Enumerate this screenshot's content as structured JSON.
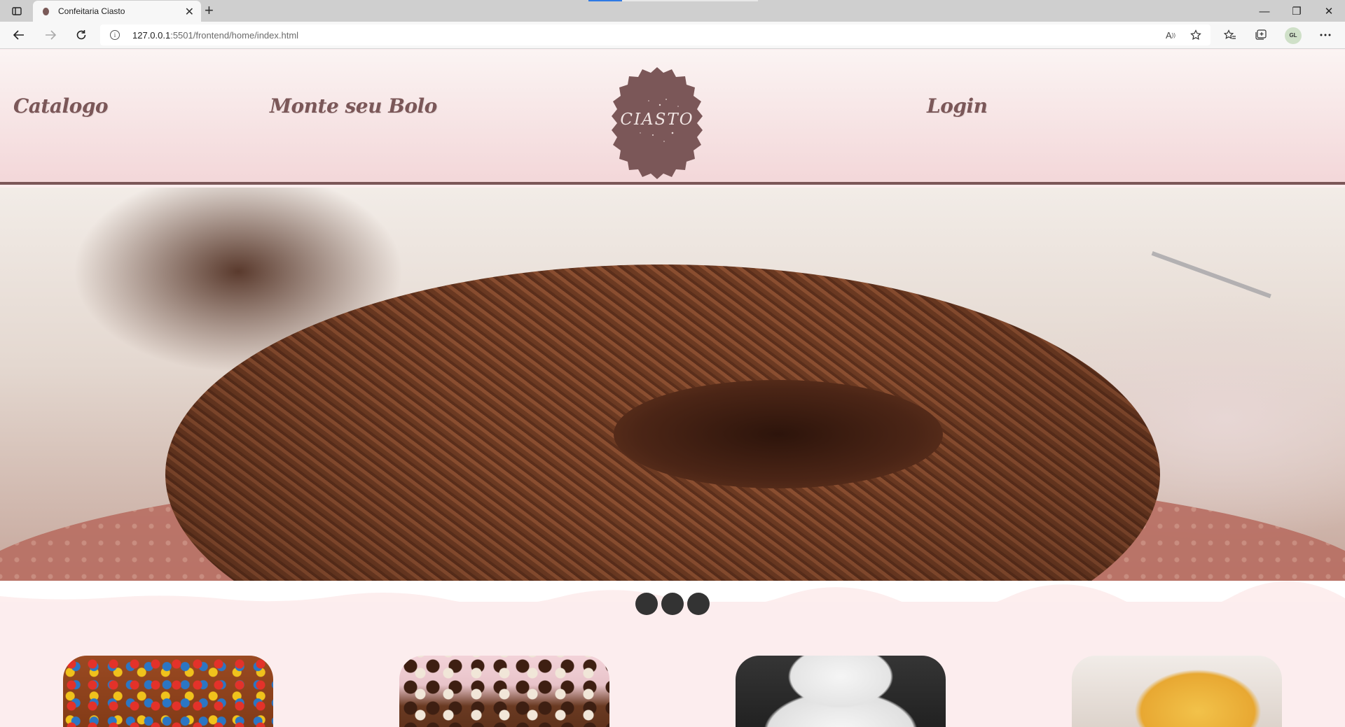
{
  "browser": {
    "tab_title": "Confeitaria Ciasto",
    "tab_close": "✕",
    "new_tab": "+",
    "url_host": "127.0.0.1",
    "url_rest": ":5501/frontend/home/index.html",
    "profile_initials": "GL",
    "window_controls": {
      "minimize": "—",
      "restore": "❐",
      "close": "✕"
    }
  },
  "site": {
    "nav": {
      "catalog": "Catalogo",
      "build_cake": "Monte seu Bolo",
      "login": "Login"
    },
    "logo_text": "CIASTO",
    "brand_color": "#7b5758",
    "header_gradient": [
      "#fbf4f3",
      "#f3d7d9"
    ],
    "slider": {
      "dots": [
        {
          "label": "slide-1"
        },
        {
          "label": "slide-2"
        },
        {
          "label": "slide-3"
        }
      ],
      "dot_color": "#333333"
    },
    "products": [
      {
        "image": "kitkat-mms-cake"
      },
      {
        "image": "brigadeiro-truffle-cake"
      },
      {
        "image": "white-tiered-cake"
      },
      {
        "image": "sponge-cake-powdered-sugar"
      }
    ]
  }
}
